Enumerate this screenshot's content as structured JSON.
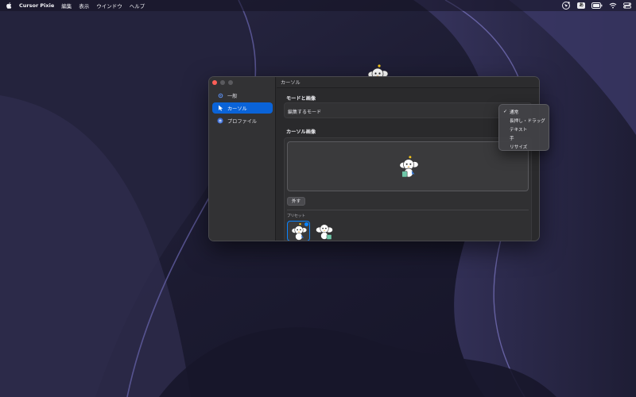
{
  "menubar": {
    "app_name": "Cursor Pixie",
    "items": [
      "編集",
      "表示",
      "ウインドウ",
      "ヘルプ"
    ],
    "input_badge": "あ"
  },
  "window": {
    "title": "カーソル",
    "sidebar": {
      "items": [
        {
          "label": "一般",
          "icon": "gear-icon",
          "active": false
        },
        {
          "label": "カーソル",
          "icon": "pointer-icon",
          "active": true
        },
        {
          "label": "プロファイル",
          "icon": "layers-icon",
          "active": false
        }
      ]
    },
    "mode_section": {
      "title": "モードと画像",
      "edit_mode_label": "編集するモード"
    },
    "image_section": {
      "title": "カーソル画像",
      "remove_button": "外す",
      "presets_label": "プリセット"
    }
  },
  "mode_menu": {
    "selected_index": 0,
    "options": [
      "通常",
      "長押し・ドラッグ",
      "テキスト",
      "手",
      "リサイズ"
    ]
  },
  "colors": {
    "accent": "#0a63d8",
    "close": "#ff5f57",
    "window_bg": "#2a2a2c"
  }
}
